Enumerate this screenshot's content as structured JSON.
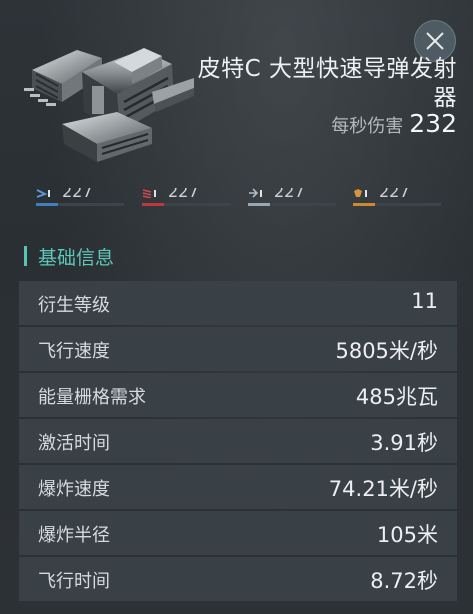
{
  "module": {
    "name": "皮特C 大型快速导弹发射器",
    "dps_label": "每秒伤害",
    "dps_value": "232"
  },
  "damage": [
    {
      "type": "kinetic",
      "icon": "kinetic-damage-icon",
      "value": "227",
      "color": "#3f7fbf"
    },
    {
      "type": "thermal",
      "icon": "thermal-damage-icon",
      "value": "227",
      "color": "#c0383f"
    },
    {
      "type": "em",
      "icon": "em-damage-icon",
      "value": "227",
      "color": "#9aa7b2"
    },
    {
      "type": "explosive",
      "icon": "explosive-damage-icon",
      "value": "227",
      "color": "#d08a2e"
    }
  ],
  "section": {
    "title": "基础信息",
    "accent": "#59c4b6"
  },
  "attributes": [
    {
      "name": "衍生等级",
      "value": "11"
    },
    {
      "name": "飞行速度",
      "value": "5805米/秒"
    },
    {
      "name": "能量栅格需求",
      "value": "485兆瓦"
    },
    {
      "name": "激活时间",
      "value": "3.91秒"
    },
    {
      "name": "爆炸速度",
      "value": "74.21米/秒"
    },
    {
      "name": "爆炸半径",
      "value": "105米"
    },
    {
      "name": "飞行时间",
      "value": "8.72秒"
    }
  ]
}
